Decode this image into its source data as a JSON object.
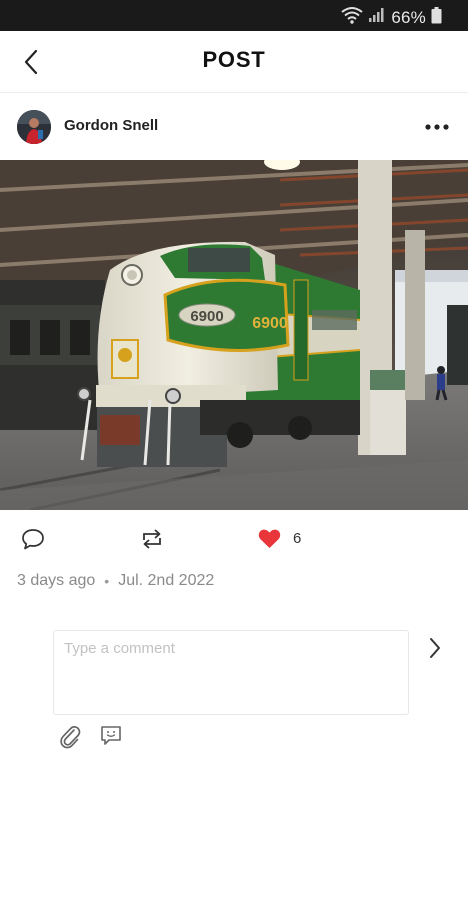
{
  "status_bar": {
    "battery_text": "66%",
    "icons": [
      "wifi-icon",
      "signal-icon",
      "battery-icon"
    ]
  },
  "header": {
    "title": "POST",
    "back_icon": "chevron-left-icon"
  },
  "post": {
    "author": "Gordon Snell",
    "more_icon": "more-horizontal-icon",
    "photo_text": {
      "number_plate": "6900",
      "cab_number": "6900"
    },
    "actions": {
      "comment_icon": "comment-icon",
      "repost_icon": "repost-icon",
      "like_icon": "heart-icon",
      "like_count": "6"
    },
    "meta": {
      "relative_time": "3 days ago",
      "separator": "•",
      "date": "Jul. 2nd 2022"
    }
  },
  "comment": {
    "placeholder": "Type a comment",
    "send_icon": "chevron-right-icon",
    "attach_icon": "paperclip-icon",
    "emoji_icon": "emoji-comment-icon"
  },
  "colors": {
    "status_bar": "#1a1a1a",
    "like_heart": "#e8363a",
    "train_green": "#2d7a34",
    "train_cream": "#ece9d8",
    "train_stripe": "#d6a21e"
  }
}
